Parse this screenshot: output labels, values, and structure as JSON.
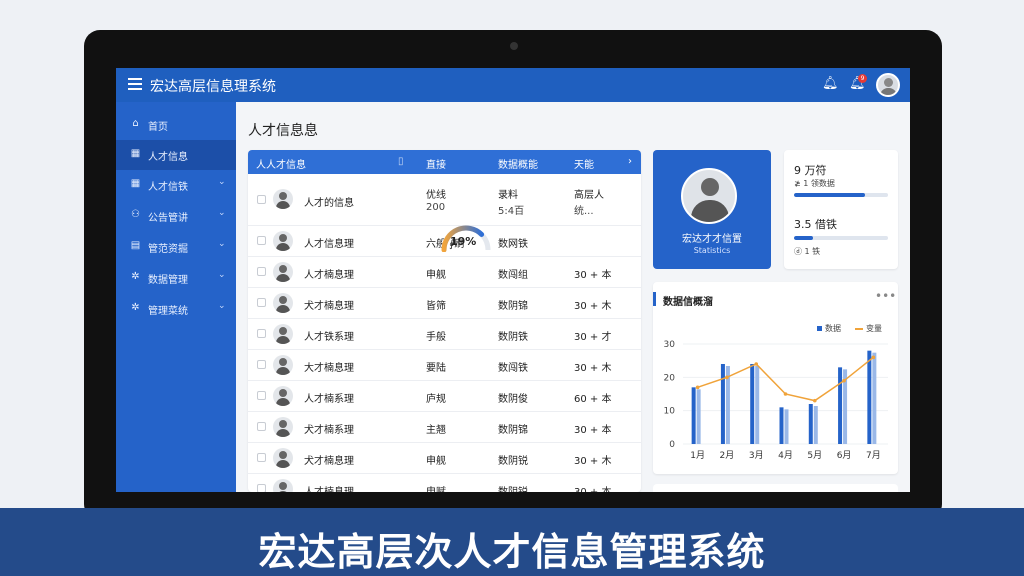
{
  "app": {
    "title": "宏达高层信息理系统"
  },
  "header": {
    "notification_count": "9"
  },
  "sidebar": {
    "items": [
      {
        "label": "首页",
        "icon": "home-icon",
        "glyph": "⌂"
      },
      {
        "label": "人才信息",
        "icon": "list-icon",
        "glyph": "▦"
      },
      {
        "label": "人才信铁",
        "icon": "grid-icon",
        "glyph": "▦"
      },
      {
        "label": "公告管讲",
        "icon": "users-icon",
        "glyph": "⚇"
      },
      {
        "label": "管范资掘",
        "icon": "folder-icon",
        "glyph": "▤"
      },
      {
        "label": "数据管理",
        "icon": "settings-icon",
        "glyph": "✲"
      },
      {
        "label": "管理菜统",
        "icon": "gear-icon",
        "glyph": "✲"
      }
    ]
  },
  "main": {
    "title": "人才信息息"
  },
  "table": {
    "headers": [
      "人人才信息",
      "直接",
      "数据概能",
      "天能"
    ],
    "rows": [
      {
        "name": "人才的信息",
        "c2": "优线",
        "c2b": "200",
        "c3": "录料",
        "c3b": "5:4百",
        "c4": "高层人",
        "c4b": "统..."
      },
      {
        "name": "人才信息理",
        "c2": "六般 ∮刷",
        "c3": "数网铁",
        "c4": ""
      },
      {
        "name": "人才楠息理",
        "c2": "申舰",
        "c3": "数闯组",
        "c4": "30 + 本"
      },
      {
        "name": "犬才楠息理",
        "c2": "皆筛",
        "c3": "数阴锦",
        "c4": "30 + 木"
      },
      {
        "name": "人才铁系理",
        "c2": "手般",
        "c3": "数阴铁",
        "c4": "30 + 才"
      },
      {
        "name": "大才楠息理",
        "c2": "要陆",
        "c3": "数闯铁",
        "c4": "30 + 木"
      },
      {
        "name": "人才楠系理",
        "c2": "庐规",
        "c3": "数阴俊",
        "c4": "60 + 本"
      },
      {
        "name": "犬才楠系理",
        "c2": "主翘",
        "c3": "数阴锦",
        "c4": "30 + 本"
      },
      {
        "name": "犬才楠息理",
        "c2": "申舰",
        "c3": "数阴锐",
        "c4": "30 + 木"
      },
      {
        "name": "人才楠息理",
        "c2": "申赋",
        "c3": "数阴锐",
        "c4": "30 + 本"
      }
    ],
    "gauge": {
      "label": "19%",
      "value": 0.75,
      "color_start": "#f3a53b",
      "color_end": "#2f6fd6"
    }
  },
  "profile": {
    "name": "宏达才才信置",
    "subtitle": "Statistics"
  },
  "stats": [
    {
      "value": "9 万符",
      "label": "≱ 1 领数据",
      "progress": 0.75
    },
    {
      "value": "3.5 借铁",
      "label": "ⓓ 1 铁",
      "progress": 0.2
    }
  ],
  "chart_data": {
    "type": "bar",
    "title": "数据信概溜",
    "categories": [
      "1月",
      "2月",
      "3月",
      "4月",
      "5月",
      "6月",
      "7月"
    ],
    "ylim": [
      0,
      30
    ],
    "yticks": [
      "0",
      "10",
      "20",
      "30",
      "40",
      "20",
      "30"
    ],
    "series": [
      {
        "name": "数据",
        "type": "bar",
        "values": [
          17,
          24,
          24,
          11,
          12,
          23,
          28
        ],
        "color": "#2563c9"
      },
      {
        "name": "变量",
        "type": "line",
        "values": [
          17,
          20,
          24,
          15,
          13,
          19,
          26
        ],
        "color": "#f0a33a"
      }
    ]
  },
  "banner": {
    "text": "宏达高层次人才信息管理系统"
  }
}
